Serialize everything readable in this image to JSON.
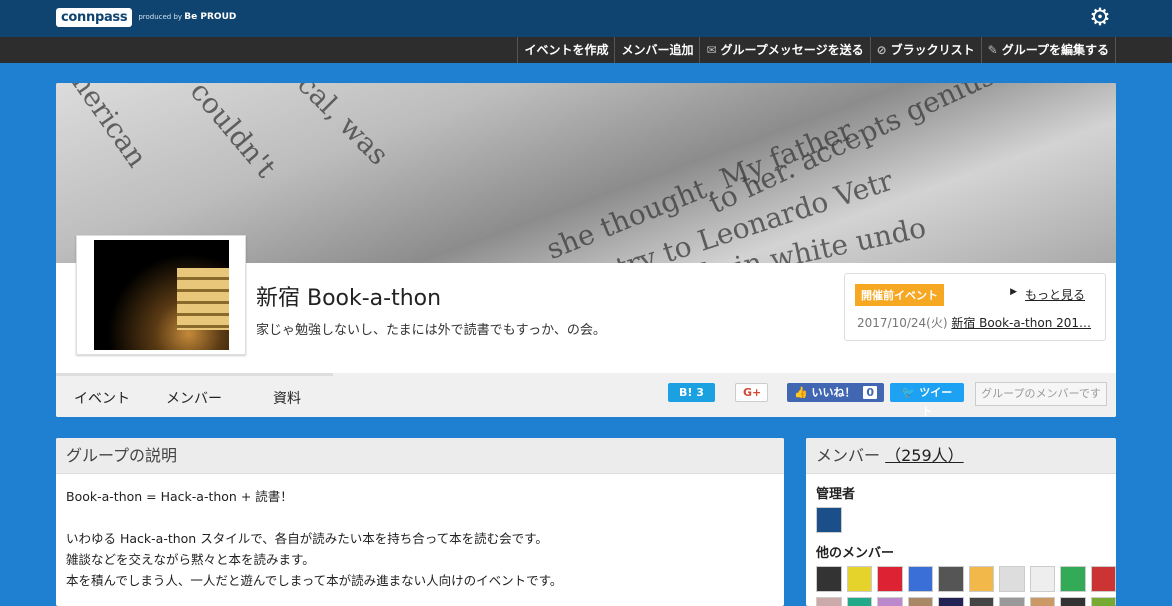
{
  "header": {
    "logo": "connpass",
    "produced_by": "produced by",
    "produced_brand": "Be PROUD"
  },
  "admin_menu": [
    {
      "label": "イベントを作成",
      "icon": ""
    },
    {
      "label": "メンバー追加",
      "icon": ""
    },
    {
      "label": "グループメッセージを送る",
      "icon": "✉"
    },
    {
      "label": "ブラックリスト",
      "icon": "⊘"
    },
    {
      "label": "グループを編集する",
      "icon": "✎"
    }
  ],
  "group": {
    "title": "新宿 Book-a-thon",
    "description": "家じゃ勉強しないし、たまには外で読書でもすっか、の会。"
  },
  "upcoming": {
    "badge": "開催前イベント",
    "more": "もっと見る",
    "date": "2017/10/24(火)",
    "event_title": "新宿 Book-a-thon 201…"
  },
  "tabs": [
    "イベント",
    "メンバー",
    "資料"
  ],
  "share": {
    "hatena": "B! 3",
    "google": "G+",
    "facebook": "いいね！",
    "facebook_count": "0",
    "twitter": "ツイート",
    "member_status": "グループのメンバーです"
  },
  "description_panel": {
    "title": "グループの説明",
    "lines": [
      "Book-a-thon = Hack-a-thon + 読書！",
      "",
      "いわゆる Hack-a-thon スタイルで、各自が読みたい本を持ち合って本を読む会です。",
      "雑談などを交えながら黙々と本を読みます。",
      "本を積んでしまう人、一人だと遊んでしまって本が読み進まない人向けのイベントです。"
    ]
  },
  "member_panel": {
    "title": "メンバー",
    "count": "（259人）",
    "admins_label": "管理者",
    "others_label": "他のメンバー",
    "admin_avatar_colors": [
      "#1b4f8a"
    ],
    "member_avatar_colors_row1": [
      "#333",
      "#e5d22a",
      "#d23",
      "#3a6fd8",
      "#555",
      "#f2b84a",
      "#ddd",
      "#eee",
      "#3a5",
      "#c33"
    ],
    "member_avatar_colors_row2": [
      "#caa",
      "#2a8",
      "#b8c",
      "#a86",
      "#225",
      "#444",
      "#999",
      "#c96",
      "#333",
      "#7a3"
    ]
  }
}
